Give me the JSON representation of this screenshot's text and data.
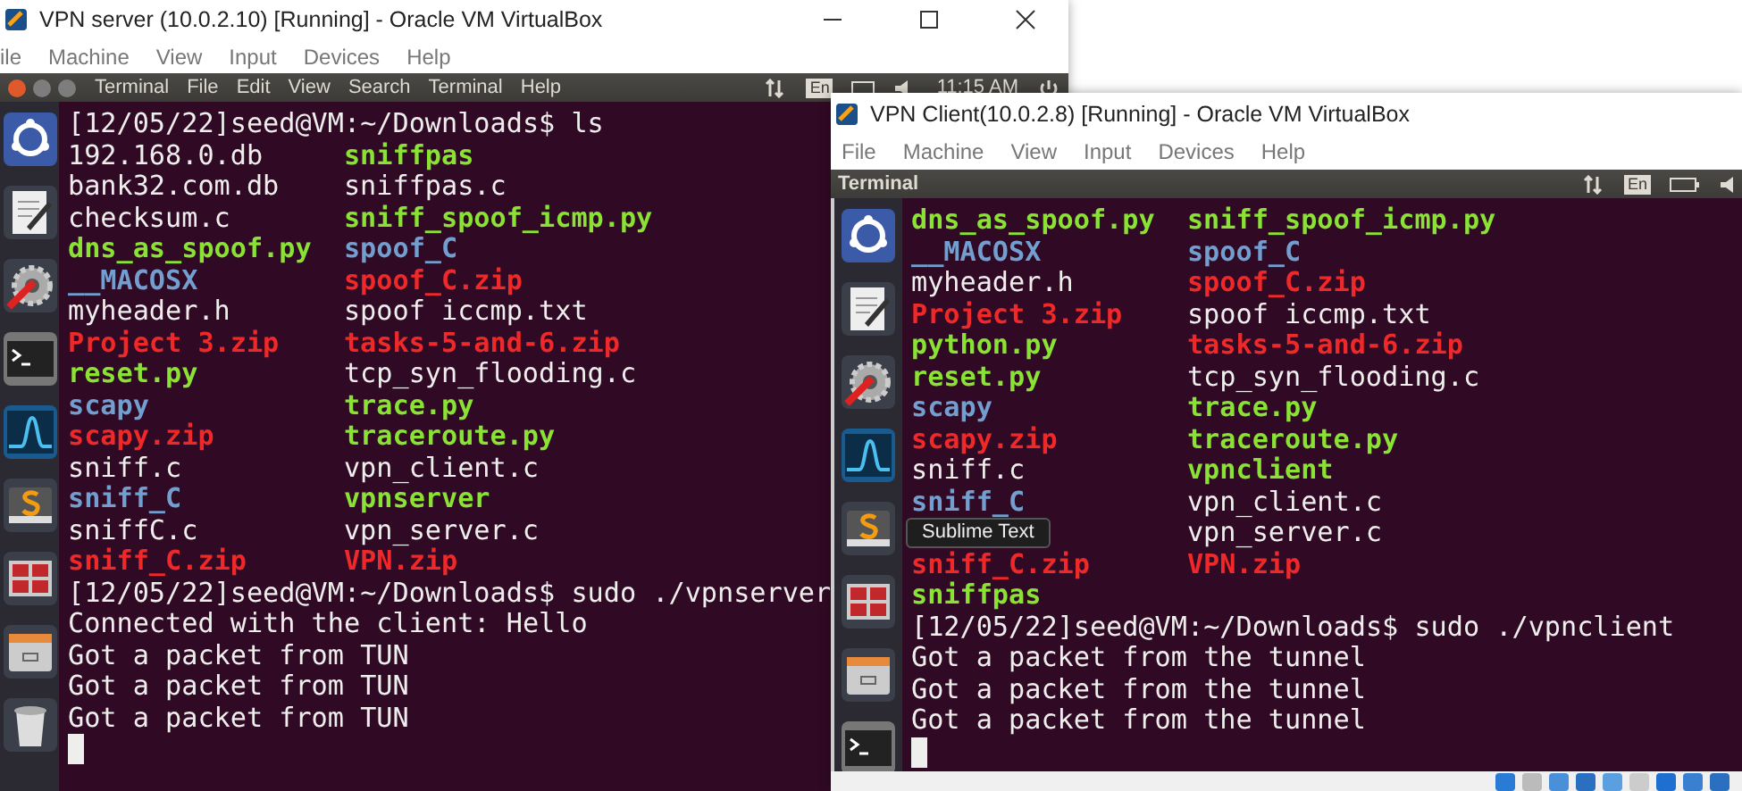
{
  "windows": [
    {
      "title": "VPN server (10.0.2.10) [Running] - Oracle VM VirtualBox",
      "menu": [
        "ile",
        "Machine",
        "View",
        "Input",
        "Devices",
        "Help"
      ],
      "panel": {
        "menu": [
          "Terminal",
          "File",
          "Edit",
          "View",
          "Search",
          "Terminal",
          "Help"
        ],
        "indicators": [
          {
            "kind": "keyboard",
            "text": "En"
          },
          {
            "kind": "clock",
            "text": "11:15 AM"
          }
        ]
      },
      "terminal": {
        "lines": [
          {
            "kind": "prompt",
            "text": "[12/05/22]seed@VM:~/Downloads$ ls"
          },
          {
            "kind": "listing",
            "left": {
              "text": "192.168.0.db",
              "kind": "file"
            },
            "right": {
              "text": "sniffpas",
              "kind": "exe"
            }
          },
          {
            "kind": "listing",
            "left": {
              "text": "bank32.com.db",
              "kind": "file"
            },
            "right": {
              "text": "sniffpas.c",
              "kind": "file"
            }
          },
          {
            "kind": "listing",
            "left": {
              "text": "checksum.c",
              "kind": "file"
            },
            "right": {
              "text": "sniff_spoof_icmp.py",
              "kind": "exe"
            }
          },
          {
            "kind": "listing",
            "left": {
              "text": "dns_as_spoof.py",
              "kind": "exe"
            },
            "right": {
              "text": "spoof_C",
              "kind": "dir"
            }
          },
          {
            "kind": "listing",
            "left": {
              "text": "__MACOSX",
              "kind": "dir"
            },
            "right": {
              "text": "spoof_C.zip",
              "kind": "archive"
            }
          },
          {
            "kind": "listing",
            "left": {
              "text": "myheader.h",
              "kind": "file"
            },
            "right": {
              "text": "spoof iccmp.txt",
              "kind": "file"
            }
          },
          {
            "kind": "listing",
            "left": {
              "text": "Project 3.zip",
              "kind": "archive"
            },
            "right": {
              "text": "tasks-5-and-6.zip",
              "kind": "archive"
            }
          },
          {
            "kind": "listing",
            "left": {
              "text": "reset.py",
              "kind": "exe"
            },
            "right": {
              "text": "tcp_syn_flooding.c",
              "kind": "file"
            }
          },
          {
            "kind": "listing",
            "left": {
              "text": "scapy",
              "kind": "dir"
            },
            "right": {
              "text": "trace.py",
              "kind": "exe"
            }
          },
          {
            "kind": "listing",
            "left": {
              "text": "scapy.zip",
              "kind": "archive"
            },
            "right": {
              "text": "traceroute.py",
              "kind": "exe"
            }
          },
          {
            "kind": "listing",
            "left": {
              "text": "sniff.c",
              "kind": "file"
            },
            "right": {
              "text": "vpn_client.c",
              "kind": "file"
            }
          },
          {
            "kind": "listing",
            "left": {
              "text": "sniff_C",
              "kind": "dir"
            },
            "right": {
              "text": "vpnserver",
              "kind": "exe"
            }
          },
          {
            "kind": "listing",
            "left": {
              "text": "sniffC.c",
              "kind": "file"
            },
            "right": {
              "text": "vpn_server.c",
              "kind": "file"
            }
          },
          {
            "kind": "listing",
            "left": {
              "text": "sniff_C.zip",
              "kind": "archive"
            },
            "right": {
              "text": "VPN.zip",
              "kind": "archive"
            }
          },
          {
            "kind": "prompt",
            "text": "[12/05/22]seed@VM:~/Downloads$ sudo ./vpnserver"
          },
          {
            "kind": "output",
            "text": "Connected with the client: Hello"
          },
          {
            "kind": "output",
            "text": "Got a packet from TUN"
          },
          {
            "kind": "output",
            "text": "Got a packet from TUN"
          },
          {
            "kind": "output",
            "text": "Got a packet from TUN"
          },
          {
            "kind": "cursor"
          }
        ]
      }
    },
    {
      "title": "VPN Client(10.0.2.8) [Running] - Oracle VM VirtualBox",
      "menu": [
        "File",
        "Machine",
        "View",
        "Input",
        "Devices",
        "Help"
      ],
      "panel": {
        "title": "Terminal",
        "indicators": [
          {
            "kind": "keyboard",
            "text": "En"
          }
        ]
      },
      "tooltip": "Sublime Text",
      "terminal": {
        "lines": [
          {
            "kind": "listing",
            "left": {
              "text": "dns_as_spoof.py",
              "kind": "exe"
            },
            "right": {
              "text": "sniff_spoof_icmp.py",
              "kind": "exe"
            }
          },
          {
            "kind": "listing",
            "left": {
              "text": "__MACOSX",
              "kind": "dir"
            },
            "right": {
              "text": "spoof_C",
              "kind": "dir"
            }
          },
          {
            "kind": "listing",
            "left": {
              "text": "myheader.h",
              "kind": "file"
            },
            "right": {
              "text": "spoof_C.zip",
              "kind": "archive"
            }
          },
          {
            "kind": "listing",
            "left": {
              "text": "Project 3.zip",
              "kind": "archive"
            },
            "right": {
              "text": "spoof iccmp.txt",
              "kind": "file"
            }
          },
          {
            "kind": "listing",
            "left": {
              "text": "python.py",
              "kind": "exe"
            },
            "right": {
              "text": "tasks-5-and-6.zip",
              "kind": "archive"
            }
          },
          {
            "kind": "listing",
            "left": {
              "text": "reset.py",
              "kind": "exe"
            },
            "right": {
              "text": "tcp_syn_flooding.c",
              "kind": "file"
            }
          },
          {
            "kind": "listing",
            "left": {
              "text": "scapy",
              "kind": "dir"
            },
            "right": {
              "text": "trace.py",
              "kind": "exe"
            }
          },
          {
            "kind": "listing",
            "left": {
              "text": "scapy.zip",
              "kind": "archive"
            },
            "right": {
              "text": "traceroute.py",
              "kind": "exe"
            }
          },
          {
            "kind": "listing",
            "left": {
              "text": "sniff.c",
              "kind": "file"
            },
            "right": {
              "text": "vpnclient",
              "kind": "exe"
            }
          },
          {
            "kind": "listing",
            "left": {
              "text": "sniff_C",
              "kind": "dir"
            },
            "right": {
              "text": "vpn_client.c",
              "kind": "file"
            }
          },
          {
            "kind": "listing",
            "right": {
              "text": "vpn_server.c",
              "kind": "file"
            }
          },
          {
            "kind": "listing",
            "left": {
              "text": "sniff_C.zip",
              "kind": "archive"
            },
            "right": {
              "text": "VPN.zip",
              "kind": "archive"
            }
          },
          {
            "kind": "listing",
            "left": {
              "text": "sniffpas",
              "kind": "exe"
            }
          },
          {
            "kind": "prompt",
            "text": "[12/05/22]seed@VM:~/Downloads$ sudo ./vpnclient"
          },
          {
            "kind": "output",
            "text": "Got a packet from the tunnel"
          },
          {
            "kind": "output",
            "text": "Got a packet from the tunnel"
          },
          {
            "kind": "output",
            "text": "Got a packet from the tunnel"
          },
          {
            "kind": "cursor"
          }
        ]
      }
    }
  ]
}
